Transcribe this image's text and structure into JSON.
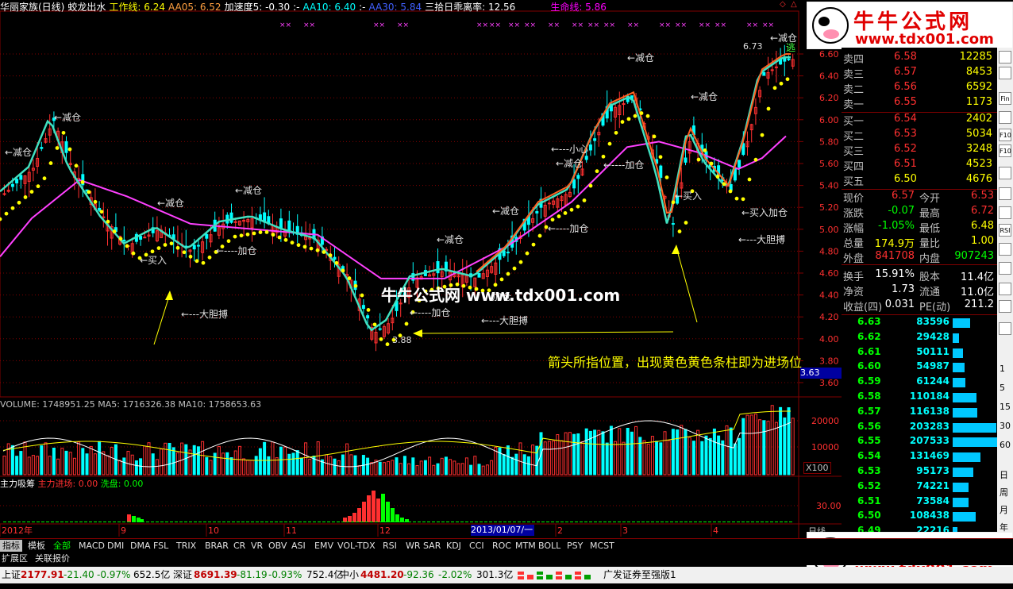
{
  "header": {
    "title": "华丽家族(日线)",
    "formula": "蛟龙出水",
    "work_line": "工作线: 6.24",
    "aa05": "AA05: 6.52",
    "accel": "加速度5: -0.30",
    "sep": ":-",
    "aa10": "AA10: 6.40",
    "sep2": ":-",
    "aa30": "AA30: 5.84",
    "ratio": "三拾日乖离率: 12.56",
    "life_line": "生命线: 5.86"
  },
  "price_axis": [
    "6.60",
    "6.40",
    "6.20",
    "6.00",
    "5.80",
    "5.60",
    "5.40",
    "5.20",
    "5.00",
    "4.80",
    "4.60",
    "4.40",
    "4.20",
    "4.00",
    "3.80",
    "3.60"
  ],
  "current_price_tag": "3.63",
  "annotations": {
    "reduce": "←减仓",
    "buy": "←买入",
    "add": "←----加仓",
    "bold": "←---大胆搏",
    "careful": "←---小心",
    "buy_add": "←买入加仓",
    "escape": "逃",
    "high": "6.73",
    "low": "3.88",
    "note": "箭头所指位置，出现黄色黄色条柱即为进场位",
    "watermark": "牛牛公式网 www.tdx001.com"
  },
  "volume": {
    "label": "VOLUME: 1748951.25",
    "ma5": "MA5: 1716326.38",
    "ma10": "MA10: 1758653.63",
    "axis": [
      "20000",
      "10000"
    ],
    "unit": "X100"
  },
  "indicator": {
    "label": "主力吸筹",
    "main_in": "主力进场: 0.00",
    "wash": "洗盘: 0.00",
    "axis": "30.00"
  },
  "time_axis": {
    "labels": [
      "2012年",
      "9",
      "10",
      "11",
      "12",
      "2013/01/07/一",
      "2",
      "3",
      "4"
    ],
    "period": "日线"
  },
  "quote": {
    "asks": [
      {
        "label": "卖四",
        "price": "6.58",
        "vol": "12285"
      },
      {
        "label": "卖三",
        "price": "6.57",
        "vol": "8453"
      },
      {
        "label": "卖二",
        "price": "6.56",
        "vol": "6592"
      },
      {
        "label": "卖一",
        "price": "6.55",
        "vol": "1173"
      }
    ],
    "bids": [
      {
        "label": "买一",
        "price": "6.54",
        "vol": "2402"
      },
      {
        "label": "买二",
        "price": "6.53",
        "vol": "5034"
      },
      {
        "label": "买三",
        "price": "6.52",
        "vol": "3248"
      },
      {
        "label": "买四",
        "price": "6.51",
        "vol": "4523"
      },
      {
        "label": "买五",
        "price": "6.50",
        "vol": "4676"
      }
    ],
    "stats": [
      {
        "l1": "现价",
        "v1": "6.57",
        "c1": "#ff3030",
        "l2": "今开",
        "v2": "6.53",
        "c2": "#ff3030"
      },
      {
        "l1": "涨跌",
        "v1": "-0.07",
        "c1": "#00ff00",
        "l2": "最高",
        "v2": "6.72",
        "c2": "#ff3030"
      },
      {
        "l1": "涨幅",
        "v1": "-1.05%",
        "c1": "#00ff00",
        "l2": "最低",
        "v2": "6.48",
        "c2": "#ffff00"
      },
      {
        "l1": "总量",
        "v1": "174.9万",
        "c1": "#ffff00",
        "l2": "量比",
        "v2": "1.00",
        "c2": "#ffff00"
      },
      {
        "l1": "外盘",
        "v1": "841708",
        "c1": "#ff3030",
        "l2": "内盘",
        "v2": "907243",
        "c2": "#00ff00"
      },
      {
        "l1": "换手",
        "v1": "15.91%",
        "c1": "#ffffff",
        "l2": "股本",
        "v2": "11.4亿",
        "c2": "#ffffff"
      },
      {
        "l1": "净资",
        "v1": "1.73",
        "c1": "#ffffff",
        "l2": "流通",
        "v2": "11.0亿",
        "c2": "#ffffff"
      },
      {
        "l1": "收益(四)",
        "v1": "0.031",
        "c1": "#ffffff",
        "l2": "PE(动)",
        "v2": "211.2",
        "c2": "#ffffff"
      }
    ],
    "depth": [
      {
        "p": "6.63",
        "v": "83596",
        "f": 0.4
      },
      {
        "p": "6.62",
        "v": "29428",
        "f": 0.14
      },
      {
        "p": "6.61",
        "v": "50111",
        "f": 0.24
      },
      {
        "p": "6.60",
        "v": "54987",
        "f": 0.26
      },
      {
        "p": "6.59",
        "v": "61244",
        "f": 0.29
      },
      {
        "p": "6.58",
        "v": "110184",
        "f": 0.53
      },
      {
        "p": "6.57",
        "v": "116138",
        "f": 0.56
      },
      {
        "p": "6.56",
        "v": "203283",
        "f": 0.98
      },
      {
        "p": "6.55",
        "v": "207533",
        "f": 1.0
      },
      {
        "p": "6.54",
        "v": "131469",
        "f": 0.63
      },
      {
        "p": "6.53",
        "v": "95173",
        "f": 0.46
      },
      {
        "p": "6.52",
        "v": "74221",
        "f": 0.36
      },
      {
        "p": "6.51",
        "v": "73584",
        "f": 0.35
      },
      {
        "p": "6.50",
        "v": "108438",
        "f": 0.52
      },
      {
        "p": "6.49",
        "v": "22216",
        "f": 0.11
      }
    ]
  },
  "sidebar": {
    "icons": [
      "Fin",
      "F10",
      "F10",
      "RSI"
    ],
    "nums": [
      "1",
      "5",
      "15",
      "30",
      "60"
    ],
    "words": [
      "日",
      "周",
      "月",
      "年"
    ]
  },
  "banner": {
    "t1": "牛牛公式网",
    "t2": "www.tdx001.com"
  },
  "tabs": [
    "指标",
    "模板",
    "全部",
    "MACD",
    "DMI",
    "DMA",
    "FSL",
    "TRIX",
    "BRAR",
    "CR",
    "VR",
    "OBV",
    "ASI",
    "EMV",
    "VOL-TDX",
    "RSI",
    "WR",
    "SAR",
    "KDJ",
    "CCI",
    "ROC",
    "MTM",
    "BOLL",
    "PSY",
    "MCST"
  ],
  "ext_tabs": [
    "扩展区",
    "关联报价"
  ],
  "status": {
    "sh_label": "上证",
    "sh_val": "2177.91",
    "sh_chg": "-21.40",
    "sh_pct": "-0.97%",
    "sh_amt": "652.5亿",
    "sz_label": "深证",
    "sz_val": "8691.39",
    "sz_chg": "-81.19",
    "sz_pct": "-0.93%",
    "sz_amt": "752.4亿",
    "zx_label": "中小",
    "zx_val": "4481.20",
    "zx_chg": "-92.36",
    "zx_pct": "-2.02%",
    "zx_amt": "301.3亿",
    "broker": "广发证券至强版1"
  }
}
